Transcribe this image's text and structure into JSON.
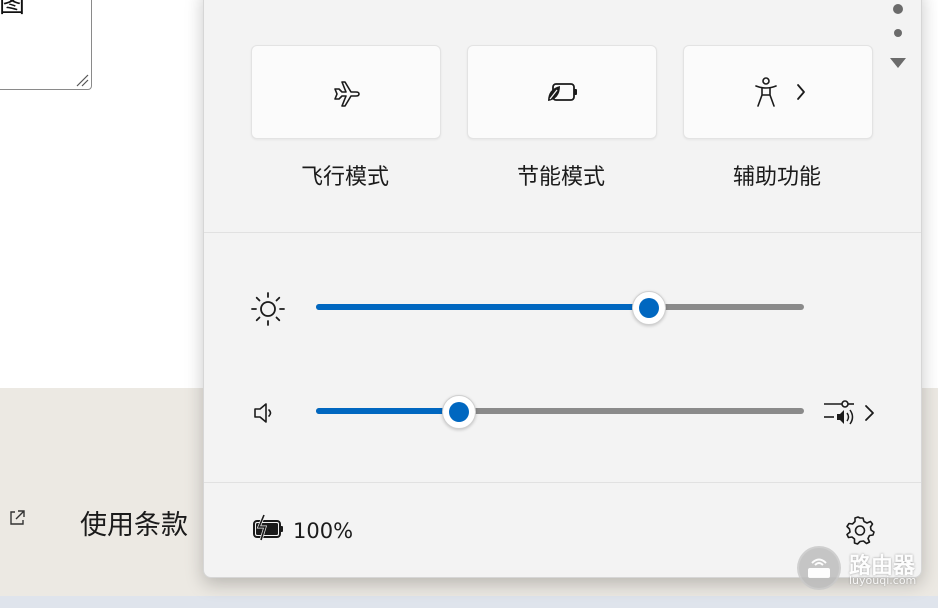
{
  "background": {
    "textarea_text": "名图",
    "terms_link": "使用条款"
  },
  "quick_settings": {
    "tiles": [
      {
        "id": "airplane",
        "label": "飞行模式",
        "icon": "airplane-icon",
        "active": false
      },
      {
        "id": "battery_saver",
        "label": "节能模式",
        "icon": "battery-saver-icon",
        "active": false
      },
      {
        "id": "accessibility",
        "label": "辅助功能",
        "icon": "accessibility-icon",
        "active": false,
        "has_submenu": true
      }
    ],
    "brightness": {
      "icon": "sun-icon",
      "value_percent": 68
    },
    "volume": {
      "icon": "speaker-icon",
      "value_percent": 29
    },
    "battery_text": "100%",
    "accent_color": "#0067c0"
  },
  "watermark": {
    "text": "路由器",
    "sub": "luyouqi.com"
  }
}
